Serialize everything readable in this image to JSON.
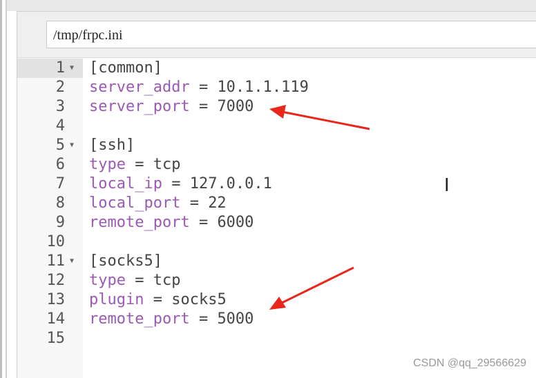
{
  "file_path": "/tmp/frpc.ini",
  "lines": [
    {
      "n": "1",
      "fold": true,
      "key": "",
      "text": "[common]"
    },
    {
      "n": "2",
      "fold": false,
      "key": "server_addr",
      "text": " = 10.1.1.119"
    },
    {
      "n": "3",
      "fold": false,
      "key": "server_port",
      "text": " = 7000"
    },
    {
      "n": "4",
      "fold": false,
      "key": "",
      "text": ""
    },
    {
      "n": "5",
      "fold": true,
      "key": "",
      "text": "[ssh]"
    },
    {
      "n": "6",
      "fold": false,
      "key": "type",
      "text": " = tcp"
    },
    {
      "n": "7",
      "fold": false,
      "key": "local_ip",
      "text": " = 127.0.0.1"
    },
    {
      "n": "8",
      "fold": false,
      "key": "local_port",
      "text": " = 22"
    },
    {
      "n": "9",
      "fold": false,
      "key": "remote_port",
      "text": " = 6000"
    },
    {
      "n": "10",
      "fold": false,
      "key": "",
      "text": ""
    },
    {
      "n": "11",
      "fold": true,
      "key": "",
      "text": "[socks5]"
    },
    {
      "n": "12",
      "fold": false,
      "key": "type",
      "text": " = tcp"
    },
    {
      "n": "13",
      "fold": false,
      "key": "plugin",
      "text": " = socks5"
    },
    {
      "n": "14",
      "fold": false,
      "key": "remote_port",
      "text": " = 5000"
    },
    {
      "n": "15",
      "fold": false,
      "key": "",
      "text": ""
    }
  ],
  "watermark": "CSDN @qq_29566629",
  "colors": {
    "key": "#9b59b6",
    "arrow": "#e8261c"
  }
}
